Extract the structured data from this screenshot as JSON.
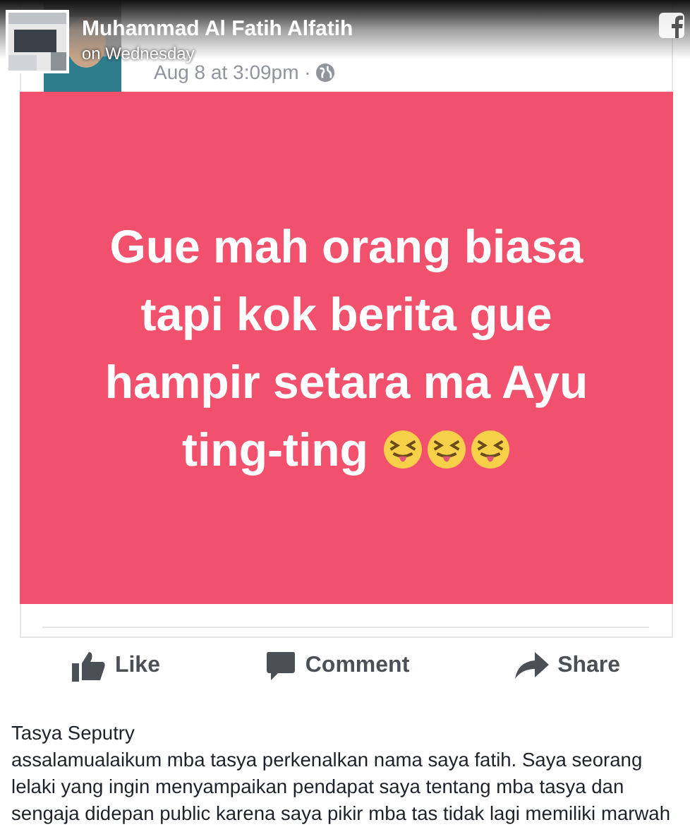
{
  "header": {
    "author": "Muhammad Al Fatih Alfatih",
    "time": "on Wednesday"
  },
  "shared_post": {
    "timestamp": "Aug 8 at 3:09pm ·",
    "image_text": [
      "Gue mah orang biasa",
      "tapi kok berita gue",
      "hampir setara ma Ayu",
      "ting-ting"
    ],
    "emojis": [
      {
        "kind": "squint-tongue"
      },
      {
        "kind": "squint-tongue"
      },
      {
        "kind": "squint-tongue"
      }
    ],
    "actions": [
      {
        "kind": "like",
        "label": "Like"
      },
      {
        "kind": "comment",
        "label": "Comment"
      },
      {
        "kind": "share",
        "label": "Share"
      }
    ]
  },
  "caption": {
    "name": "Tasya Seputry",
    "text": "assalamualaikum mba tasya perkenalkan nama saya fatih. Saya seorang lelaki yang ingin menyampaikan pendapat saya tentang mba tasya dan sengaja didepan public karena saya pikir mba tas tidak lagi memiliki marwah"
  }
}
